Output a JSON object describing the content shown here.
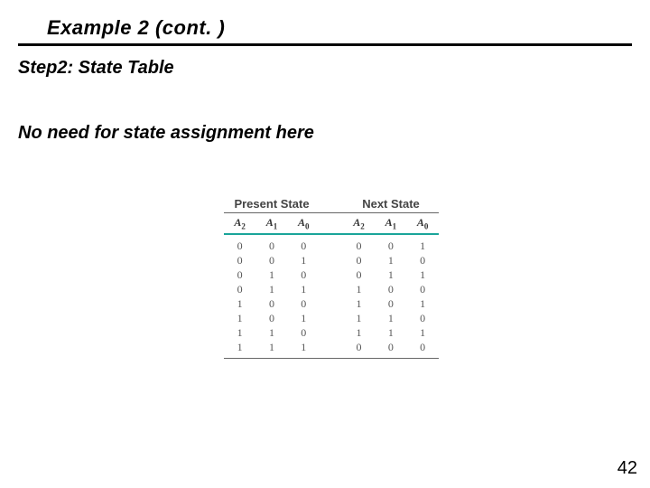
{
  "title": "Example 2 (cont. )",
  "step": "Step2: State Table",
  "note": "No need for state assignment here",
  "page_number": "42",
  "chart_data": {
    "type": "table",
    "title": "",
    "groups": [
      "Present State",
      "Next State"
    ],
    "columns": [
      "A2",
      "A1",
      "A0",
      "A2",
      "A1",
      "A0"
    ],
    "rows": [
      [
        "0",
        "0",
        "0",
        "0",
        "0",
        "1"
      ],
      [
        "0",
        "0",
        "1",
        "0",
        "1",
        "0"
      ],
      [
        "0",
        "1",
        "0",
        "0",
        "1",
        "1"
      ],
      [
        "0",
        "1",
        "1",
        "1",
        "0",
        "0"
      ],
      [
        "1",
        "0",
        "0",
        "1",
        "0",
        "1"
      ],
      [
        "1",
        "0",
        "1",
        "1",
        "1",
        "0"
      ],
      [
        "1",
        "1",
        "0",
        "1",
        "1",
        "1"
      ],
      [
        "1",
        "1",
        "1",
        "0",
        "0",
        "0"
      ]
    ]
  }
}
